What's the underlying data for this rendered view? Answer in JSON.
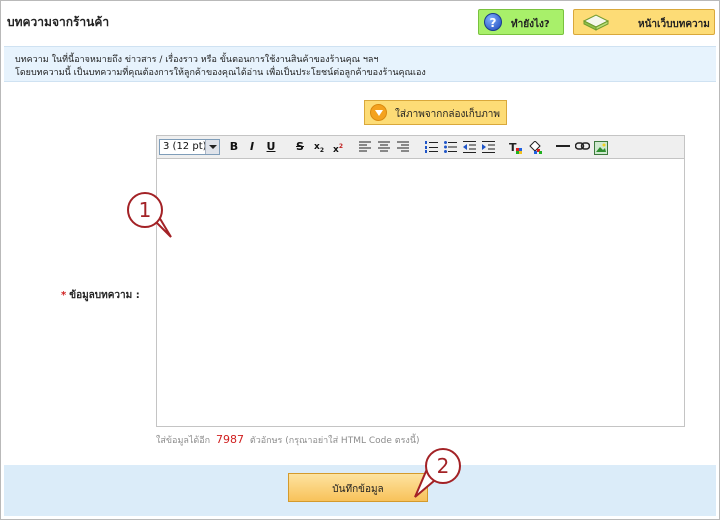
{
  "header": {
    "title": "บทความจากร้านค้า",
    "help_label": "ทำยังไง?",
    "articles_label": "หน้าเว็บบทความ"
  },
  "info": {
    "line1": "บทความ ในที่นี้อาจหมายถึง ข่าวสาร / เรื่องราว หรือ ขั้นตอนการใช้งานสินค้าของร้านคุณ ฯลฯ",
    "line2": "โดยบทความนี้ เป็นบทความที่คุณต้องการให้ลูกค้าของคุณได้อ่าน เพื่อเป็นประโยชน์ต่อลูกค้าของร้านคุณเอง"
  },
  "form": {
    "gallery_button": "ใส่ภาพจากกล่องเก็บภาพ",
    "font_size": "3 (12 pt)",
    "required_mark": "*",
    "field_label": "ข้อมูลบทความ :",
    "hint_prefix": "ใส่ข้อมูลได้อีก",
    "remaining_chars": "7987",
    "hint_suffix": "ตัวอักษร (กรุณาอย่าใส่ HTML Code ตรงนี้)",
    "save_button": "บันทึกข้อมูล"
  },
  "toolbar_icons": [
    "bold-icon",
    "italic-icon",
    "underline-icon",
    "strikethrough-icon",
    "subscript-icon",
    "superscript-icon",
    "align-left-icon",
    "align-center-icon",
    "align-right-icon",
    "ordered-list-icon",
    "unordered-list-icon",
    "outdent-icon",
    "indent-icon",
    "text-color-icon",
    "background-color-icon",
    "horizontal-rule-icon",
    "link-icon",
    "insert-image-icon"
  ],
  "callouts": {
    "one": "1",
    "two": "2"
  },
  "colors": {
    "accent_red": "#a32226",
    "help_green": "#a8f06a",
    "yellow_button": "#fddc76",
    "info_blue": "#e7f3fd",
    "footer_blue": "#dbecf9"
  }
}
